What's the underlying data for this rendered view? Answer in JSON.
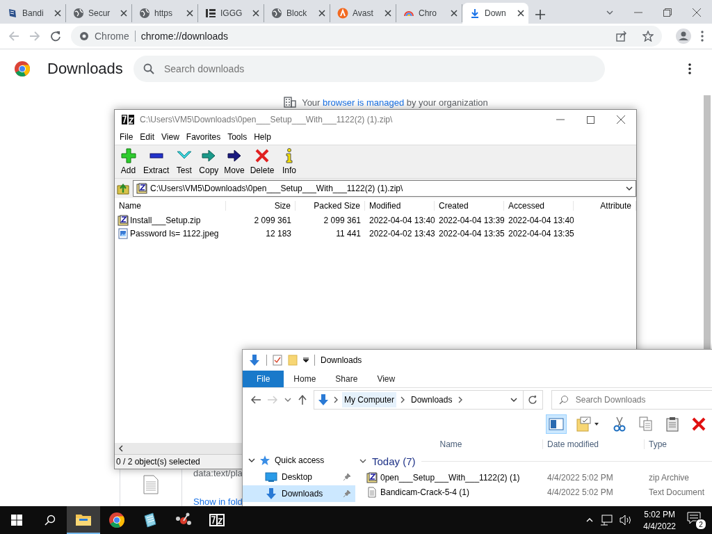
{
  "browser": {
    "tabs": [
      {
        "title": "Bandi",
        "kind": "document",
        "selected": false
      },
      {
        "title": "Secur",
        "kind": "globe",
        "selected": false
      },
      {
        "title": "https",
        "kind": "globe",
        "selected": false
      },
      {
        "title": "IGGG",
        "kind": "blocks",
        "selected": false
      },
      {
        "title": "Block",
        "kind": "globe",
        "selected": false
      },
      {
        "title": "Avast",
        "kind": "orange",
        "selected": false
      },
      {
        "title": "Chro",
        "kind": "rainbow",
        "selected": false
      },
      {
        "title": "Down",
        "kind": "download",
        "selected": true
      }
    ],
    "omnibox": {
      "chip": "Chrome",
      "url": "chrome://downloads"
    },
    "page": {
      "title": "Downloads",
      "search": {
        "placeholder": "Search downloads"
      },
      "managed_notice": {
        "before": "Your",
        "link": "browser is managed",
        "after": "by your organization"
      },
      "download_item": {
        "url": "data:text/pla",
        "action": "Show in fold"
      }
    }
  },
  "archiver": {
    "title": "C:\\Users\\VM5\\Downloads\\0pen___Setup___With___1122(2) (1).zip\\",
    "menu": [
      "File",
      "Edit",
      "View",
      "Favorites",
      "Tools",
      "Help"
    ],
    "tools": [
      {
        "kind": "add",
        "label": "Add"
      },
      {
        "kind": "extract",
        "label": "Extract"
      },
      {
        "kind": "test",
        "label": "Test"
      },
      {
        "kind": "copy",
        "label": "Copy"
      },
      {
        "kind": "move",
        "label": "Move"
      },
      {
        "kind": "delete",
        "label": "Delete"
      },
      {
        "kind": "info",
        "label": "Info"
      }
    ],
    "path": "C:\\Users\\VM5\\Downloads\\0pen___Setup___With___1122(2) (1).zip\\",
    "columns": [
      "Name",
      "Size",
      "Packed Size",
      "Modified",
      "Created",
      "Accessed",
      "Attribute"
    ],
    "rows": [
      {
        "kind": "zip",
        "cells": [
          "Install___Setup.zip",
          "2 099 361",
          "2 099 361",
          "2022-04-04 13:40",
          "2022-04-04 13:39",
          "2022-04-04 13:40"
        ]
      },
      {
        "kind": "image",
        "cells": [
          "Password Is= 1122.jpeg",
          "12 183",
          "11 441",
          "2022-04-02 13:43",
          "2022-04-04 13:35",
          "2022-04-04 13:35"
        ]
      }
    ],
    "status": "0 / 2 object(s) selected"
  },
  "explorer": {
    "title": "Downloads",
    "ribbon_tabs": [
      {
        "label": "File",
        "selected": true
      },
      {
        "label": "Home",
        "selected": false
      },
      {
        "label": "Share",
        "selected": false
      },
      {
        "label": "View",
        "selected": false
      }
    ],
    "breadcrumb": [
      "My Computer",
      "Downloads"
    ],
    "search": {
      "placeholder": "Search Downloads"
    },
    "tools": [
      {
        "kind": "preview-pane",
        "selected": true
      },
      {
        "kind": "properties",
        "selected": false
      },
      {
        "kind": "cut",
        "selected": false
      },
      {
        "kind": "copy",
        "selected": false
      },
      {
        "kind": "paste",
        "selected": false
      },
      {
        "kind": "delete",
        "selected": false
      }
    ],
    "nav": [
      {
        "label": "Quick access",
        "kind": "star",
        "expanded": true,
        "selected": false,
        "children": [
          {
            "label": "Desktop",
            "kind": "desktop",
            "pinned": true,
            "selected": false
          },
          {
            "label": "Downloads",
            "kind": "download",
            "pinned": true,
            "selected": true
          }
        ]
      }
    ],
    "columns": [
      "Name",
      "Date modified",
      "Type"
    ],
    "group": {
      "label": "Today (7)",
      "expanded": true
    },
    "files": [
      {
        "kind": "zip",
        "name": "0pen___Setup___With___1122(2) (1)",
        "date": "4/4/2022 5:02 PM",
        "type": "zip Archive"
      },
      {
        "kind": "text",
        "name": "Bandicam-Crack-5-4 (1)",
        "date": "4/4/2022 5:02 PM",
        "type": "Text Document"
      }
    ]
  },
  "taskbar": {
    "apps": [
      {
        "kind": "folder",
        "selected": true
      },
      {
        "kind": "chrome",
        "selected": false
      },
      {
        "kind": "notepad",
        "selected": false
      },
      {
        "kind": "molecule-app",
        "selected": false
      },
      {
        "kind": "archiver",
        "selected": false
      }
    ],
    "time": "5:02 PM",
    "date": "4/4/2022",
    "notifications": "2"
  }
}
